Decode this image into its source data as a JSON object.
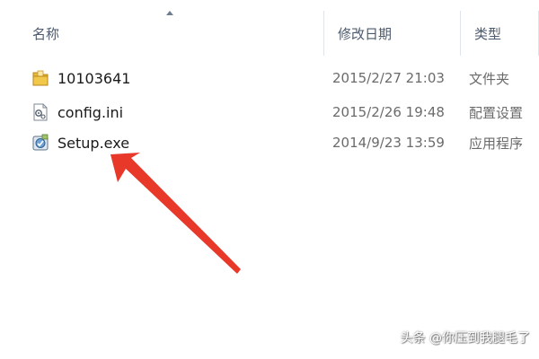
{
  "columns": {
    "name": "名称",
    "date_modified": "修改日期",
    "type": "类型"
  },
  "files": [
    {
      "name": "10103641",
      "date": "2015/2/27 21:03",
      "type": "文件夹",
      "icon": "folder-icon"
    },
    {
      "name": "config.ini",
      "date": "2015/2/26 19:48",
      "type": "配置设置",
      "icon": "config-file-icon"
    },
    {
      "name": "Setup.exe",
      "date": "2014/9/23 13:59",
      "type": "应用程序",
      "icon": "setup-exe-icon"
    }
  ],
  "colors": {
    "header_text": "#4d5a6d",
    "arrow": "#e8382a",
    "folder": "#e9b93a"
  },
  "watermark": "头条 @你压到我腿毛了"
}
